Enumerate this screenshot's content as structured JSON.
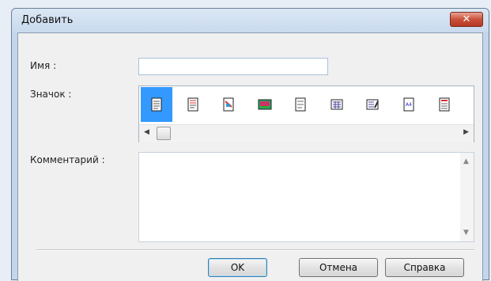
{
  "window": {
    "title": "Добавить",
    "close_glyph": "✕"
  },
  "form": {
    "name_label": "Имя :",
    "name_value": "",
    "icon_label": "Значок :",
    "comment_label": "Комментарий :",
    "comment_value": ""
  },
  "icons": [
    {
      "name": "document-lines-icon",
      "selected": true
    },
    {
      "name": "document-red-lines-icon",
      "selected": false
    },
    {
      "name": "document-image-icon",
      "selected": false
    },
    {
      "name": "photo-icon",
      "selected": false
    },
    {
      "name": "document-plain-icon",
      "selected": false
    },
    {
      "name": "document-grid-icon",
      "selected": false
    },
    {
      "name": "document-pen-icon",
      "selected": false
    },
    {
      "name": "document-a4-icon",
      "selected": false
    },
    {
      "name": "document-red-grid-icon",
      "selected": false
    }
  ],
  "buttons": {
    "ok": "OK",
    "cancel": "Отмена",
    "help": "Справка"
  },
  "scroll": {
    "left": "◀",
    "right": "▶",
    "up": "▲",
    "down": "▼"
  }
}
